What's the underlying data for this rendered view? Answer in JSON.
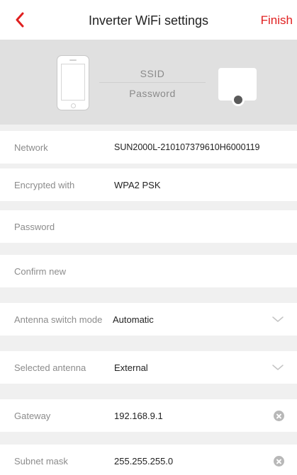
{
  "header": {
    "title": "Inverter WiFi settings",
    "finish_label": "Finish"
  },
  "banner": {
    "ssid_label": "SSID",
    "password_label": "Password"
  },
  "fields": {
    "network": {
      "label": "Network",
      "value": "SUN2000L-210107379610H6000119"
    },
    "encryption": {
      "label": "Encrypted with",
      "value": "WPA2 PSK"
    },
    "password": {
      "label": "Password",
      "value": ""
    },
    "confirm": {
      "label": "Confirm new",
      "value": ""
    },
    "antenna_mode": {
      "label": "Antenna switch mode",
      "value": "Automatic"
    },
    "selected_antenna": {
      "label": "Selected antenna",
      "value": "External"
    },
    "gateway": {
      "label": "Gateway",
      "value": "192.168.9.1"
    },
    "subnet": {
      "label": "Subnet mask",
      "value": "255.255.255.0"
    }
  },
  "colors": {
    "accent": "#e02020",
    "banner_bg": "#e0e0e0",
    "page_bg": "#f0f0f0"
  },
  "icons": {
    "back": "chevron-left-icon",
    "dropdown": "chevron-down-icon",
    "clear": "clear-circle-icon"
  }
}
